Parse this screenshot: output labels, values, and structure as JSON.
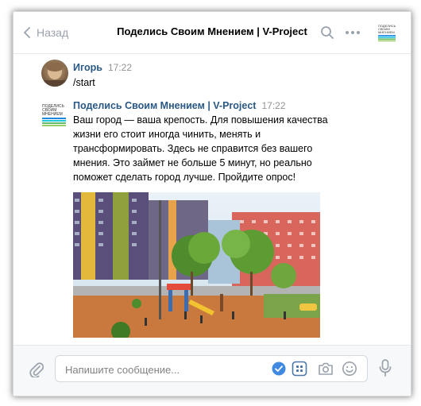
{
  "header": {
    "back_label": "Назад",
    "title": "Поделись Своим Мнением | V-Project"
  },
  "messages": [
    {
      "author": "Игорь",
      "time": "17:22",
      "text": "/start"
    },
    {
      "author": "Поделись Своим Мнением | V-Project",
      "time": "17:22",
      "text": "Ваш город — ваша крепость. Для повышения качества жизни его стоит иногда чинить, менять и трансформировать. Здесь не справится без вашего мнения. Это займет не больше 5 минут, но реально поможет сделать город лучше. Пройдите опрос!"
    }
  ],
  "logo_text": [
    "ПОДЕЛИСЬ",
    "СВОИМ",
    "МНЕНИЕМ"
  ],
  "composer": {
    "placeholder": "Напишите сообщение..."
  },
  "colors": {
    "link": "#2a5885",
    "accent": "#4a76a8",
    "muted": "#99a2ad"
  }
}
